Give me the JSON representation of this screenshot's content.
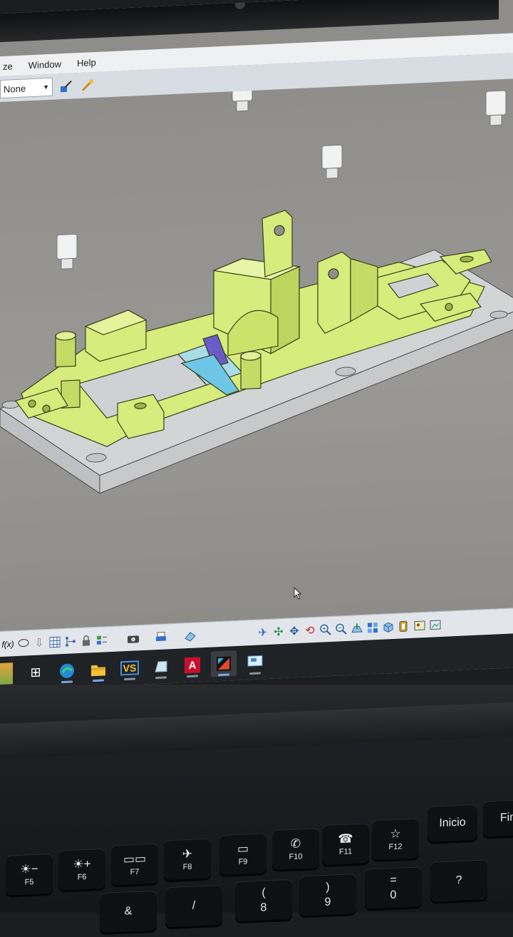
{
  "app": {
    "menus": [
      "ze",
      "Window",
      "Help"
    ],
    "layer_select": {
      "value": "None"
    }
  },
  "toolbar_top": {
    "icons": [
      "brush-icon",
      "magic-wand-icon"
    ]
  },
  "toolbar_bottom": {
    "left_icons": [
      "fx-icon",
      "speech-bubble-icon",
      "arrow-down-icon",
      "table-icon",
      "tree-icon",
      "lock-icon",
      "align-icon",
      "camera-icon",
      "print-icon",
      "eraser-icon"
    ],
    "view_icons": [
      "fly-icon",
      "fit-all-icon",
      "pan-icon",
      "rotate-icon",
      "zoom-in-icon",
      "zoom-out-icon",
      "normal-view-icon",
      "multi-view-icon",
      "cube-view-icon",
      "render-icon",
      "shading-icon",
      "snapshot-icon"
    ]
  },
  "taskbar": {
    "apps": [
      {
        "name": "task-view-icon",
        "label": "⊞"
      },
      {
        "name": "edge-icon",
        "label": ""
      },
      {
        "name": "file-explorer-icon",
        "label": ""
      },
      {
        "name": "vs-app-icon",
        "label": "VS"
      },
      {
        "name": "drive-icon",
        "label": ""
      },
      {
        "name": "autocad-icon",
        "label": "A"
      },
      {
        "name": "cad-viewer-icon",
        "label": ""
      },
      {
        "name": "monitor-app-icon",
        "label": ""
      }
    ]
  },
  "keyboard": {
    "top_row": [
      {
        "sub": "F5",
        "icon": "☀−"
      },
      {
        "sub": "F6",
        "icon": "☀+"
      },
      {
        "sub": "F7",
        "icon": "▭▭"
      },
      {
        "sub": "F8",
        "icon": "✈"
      },
      {
        "sub": "F9",
        "icon": "▭"
      },
      {
        "sub": "F10",
        "icon": "✆"
      },
      {
        "sub": "F11",
        "icon": "☎"
      },
      {
        "sub": "F12",
        "icon": "☆"
      },
      {
        "label": "Inicio"
      },
      {
        "label": "Fin"
      }
    ],
    "bottom_row": [
      "&",
      "/",
      "(",
      ")",
      "=",
      "?"
    ],
    "bottom_row_sub": [
      "",
      "",
      "8",
      "9",
      "0",
      ""
    ]
  },
  "colors": {
    "part_fill": "#d6ec7c",
    "part_shade": "#b8d05a",
    "plate_fill": "#d3d4d6",
    "viewport_bg": "#8f8e8a",
    "accent_cyan": "#6ec6e6",
    "accent_purple": "#6a5bc7"
  }
}
